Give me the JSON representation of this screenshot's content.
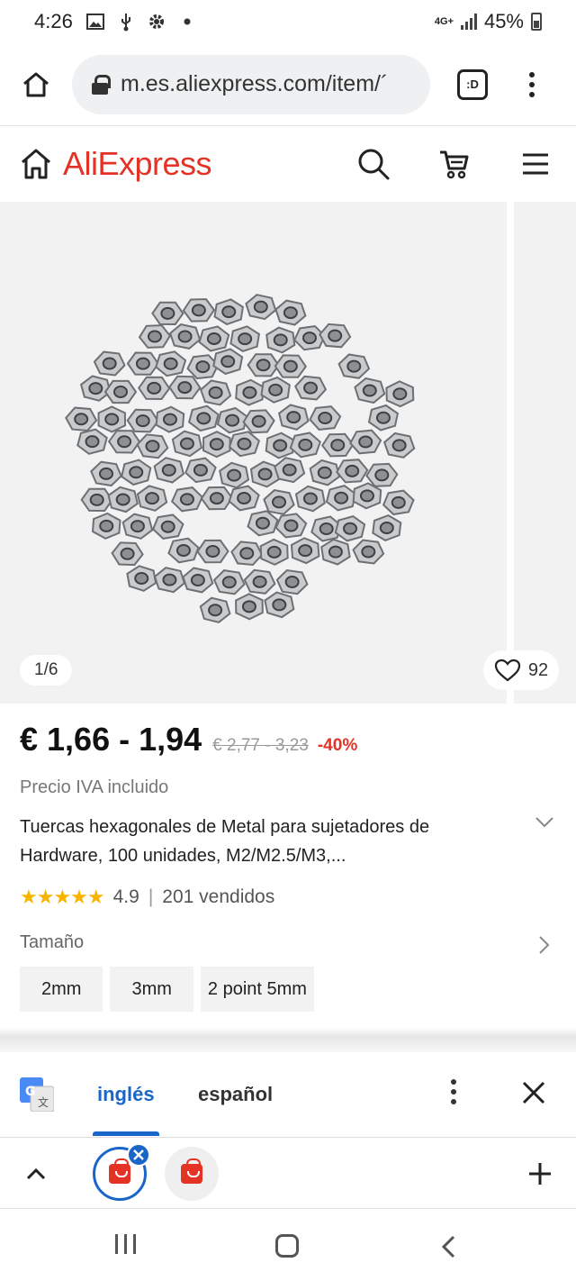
{
  "status_bar": {
    "time": "4:26",
    "network": "4G+",
    "battery": "45%",
    "icons": [
      "gallery-icon",
      "usb-icon",
      "settings-icon",
      "dot-icon"
    ]
  },
  "browser": {
    "url": "m.es.aliexpress.com/item/´",
    "tabs_label": ":D"
  },
  "header": {
    "brand": "AliExpress",
    "icons": [
      "home-icon",
      "search-icon",
      "cart-icon",
      "menu-icon"
    ]
  },
  "gallery": {
    "counter": "1/6",
    "wishlist_count": "92"
  },
  "product": {
    "price": "€ 1,66 - 1,94",
    "old_price": "€ 2,77 - 3,23",
    "discount": "-40%",
    "vat_note": "Precio IVA incluido",
    "title_line1": "Tuercas hexagonales de Metal para sujetadores de",
    "title_line2": "Hardware, 100 unidades, M2/M2.5/M3,...",
    "rating": "4.9",
    "rating_separator": "|",
    "sold": "201 vendidos",
    "star_count": 5
  },
  "size": {
    "label": "Tamaño",
    "options": [
      "2mm",
      "3mm",
      "2 point 5mm"
    ]
  },
  "translate": {
    "source_lang": "inglés",
    "target_lang": "español"
  },
  "colors": {
    "brand": "#e43225",
    "link": "#1a66c8",
    "star": "#f7b500"
  }
}
